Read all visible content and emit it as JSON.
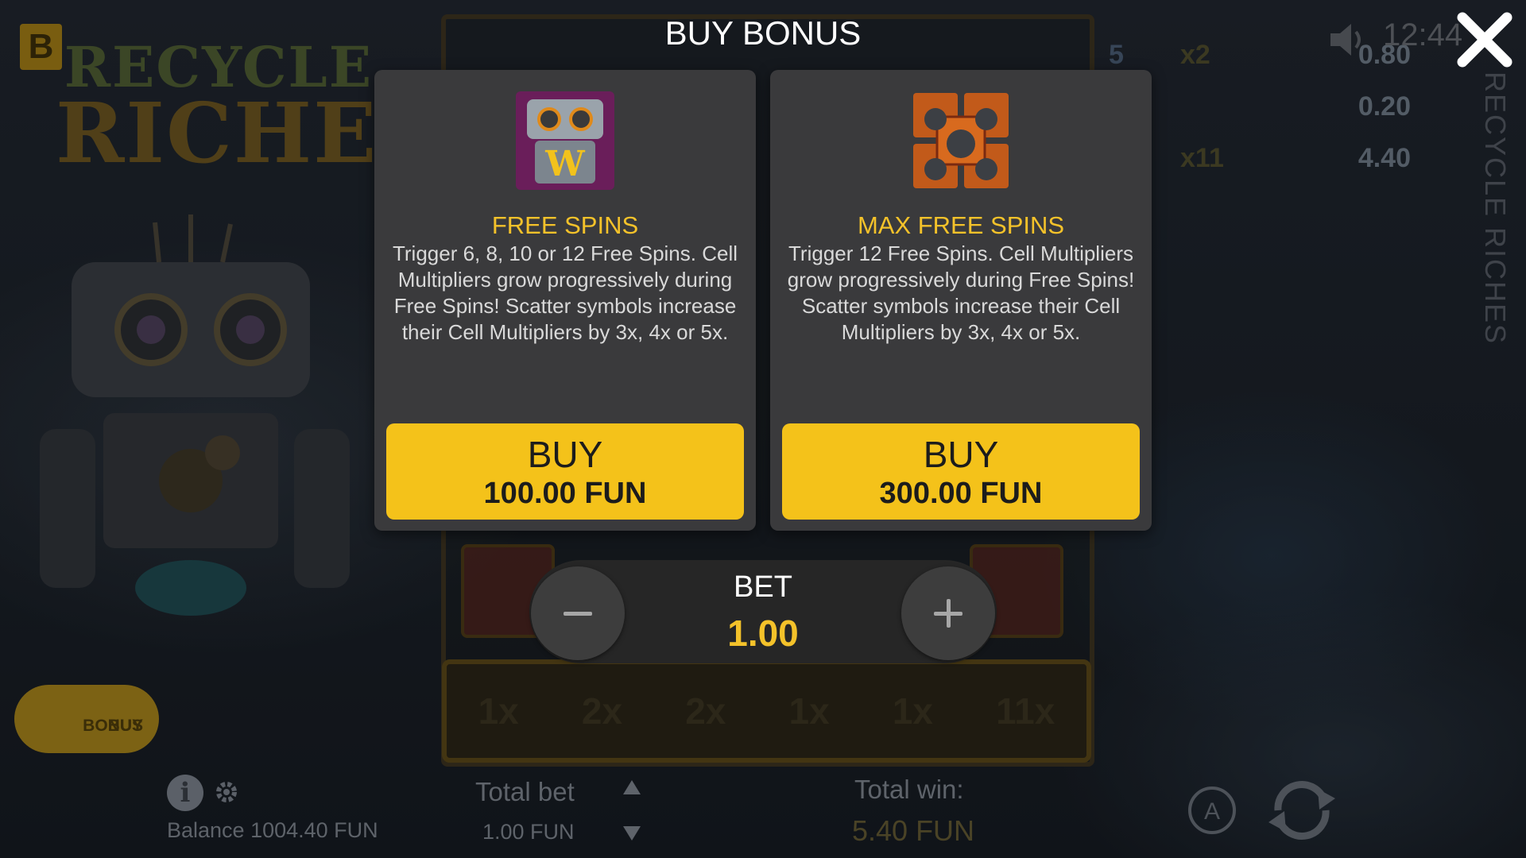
{
  "header": {
    "brand_letter": "B",
    "game_title_line1": "RECYCLE",
    "game_title_line2": "RICHES",
    "side_title": "RECYCLE RICHES",
    "clock": "12:44"
  },
  "paytable": [
    {
      "count": "5",
      "multiplier": "x2",
      "value": "0.80"
    },
    {
      "count": "",
      "multiplier": "",
      "value": "0.20"
    },
    {
      "count": "",
      "multiplier": "x11",
      "value": "4.40"
    }
  ],
  "multipliers": [
    "1x",
    "2x",
    "2x",
    "1x",
    "1x",
    "11x"
  ],
  "modal": {
    "title": "BUY BONUS",
    "cards": [
      {
        "title": "FREE SPINS",
        "description": "Trigger 6, 8, 10 or 12 Free Spins. Cell Multipliers grow progressively during Free Spins! Scatter symbols increase their Cell Multipliers by 3x, 4x or 5x.",
        "buy_label": "BUY",
        "price": "100.00 FUN",
        "icon": "robot-wild-icon"
      },
      {
        "title": "MAX FREE SPINS",
        "description": "Trigger 12 Free Spins. Cell Multipliers grow progressively during Free Spins! Scatter symbols increase their Cell Multipliers by 3x, 4x or 5x.",
        "buy_label": "BUY",
        "price": "300.00 FUN",
        "icon": "scatter-stack-icon"
      }
    ],
    "bet": {
      "label": "BET",
      "value": "1.00"
    }
  },
  "footer": {
    "buy_bonus_line1": "BUY",
    "buy_bonus_line2": "BONUS",
    "balance": "Balance 1004.40 FUN",
    "total_bet_label": "Total bet",
    "total_bet_value": "1.00 FUN",
    "total_win_label": "Total win:",
    "total_win_value": "5.40 FUN"
  },
  "colors": {
    "accent": "#f4c21a",
    "card_bg": "#3a3a3c",
    "title_yellow": "#f4c22a"
  }
}
